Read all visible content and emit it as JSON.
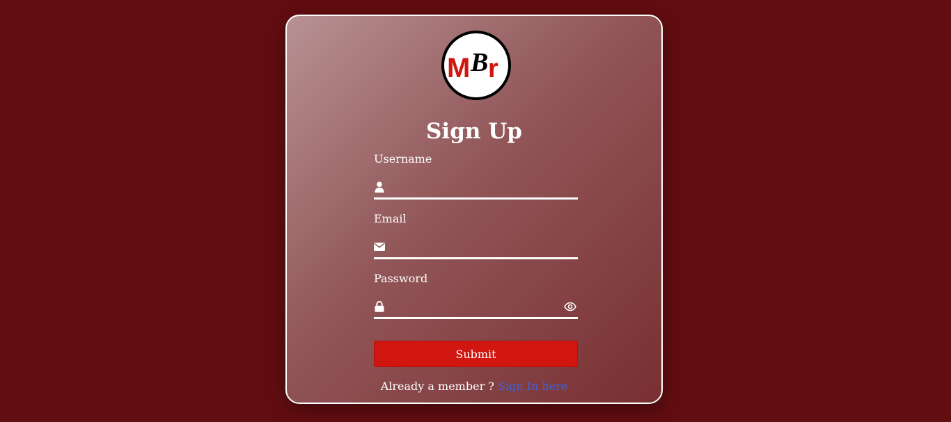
{
  "logo": {
    "letters": [
      "M",
      "B",
      "r"
    ],
    "colors": {
      "m": "#d0160f",
      "b": "#000000",
      "r": "#d0160f",
      "ring": "#000000"
    }
  },
  "form": {
    "title": "Sign Up",
    "username": {
      "label": "Username",
      "value": "",
      "icon": "user-icon"
    },
    "email": {
      "label": "Email",
      "value": "",
      "icon": "envelope-icon"
    },
    "password": {
      "label": "Password",
      "value": "",
      "icon": "lock-icon",
      "toggle_icon": "eye-icon"
    },
    "submit_label": "Submit",
    "footer": {
      "prompt": "Already a member ?",
      "link_text": "Sign In here"
    }
  },
  "colors": {
    "page_background": "#620d10",
    "accent": "#d0160f",
    "link": "#3a63e0",
    "text": "#ffffff"
  }
}
